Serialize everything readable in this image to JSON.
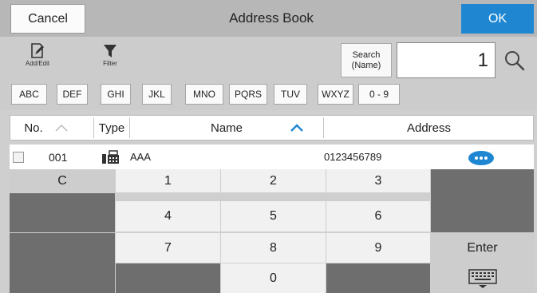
{
  "header": {
    "cancel_label": "Cancel",
    "title": "Address Book",
    "ok_label": "OK",
    "accent_color": "#1f87d2"
  },
  "toolbar": {
    "add_edit_label": "Add/Edit",
    "add_edit_icon": "edit-icon",
    "filter_label": "Filter",
    "filter_icon": "funnel-icon",
    "search_label_line1": "Search",
    "search_label_line2": "(Name)",
    "search_value": "1",
    "search_icon": "magnifier-icon"
  },
  "index_tabs": [
    "ABC",
    "DEF",
    "GHI",
    "JKL",
    "MNO",
    "PQRS",
    "TUV",
    "WXYZ",
    "0 - 9"
  ],
  "table": {
    "columns": {
      "no": "No.",
      "type": "Type",
      "name": "Name",
      "address": "Address"
    },
    "rows": [
      {
        "no": "001",
        "type_icon": "fax-icon",
        "name": "AAA",
        "address": "0123456789",
        "detail_icon": "more-icon"
      }
    ]
  },
  "keypad": {
    "clear": "C",
    "digits": [
      "1",
      "2",
      "3",
      "4",
      "5",
      "6",
      "7",
      "8",
      "9",
      "0"
    ],
    "enter": "Enter",
    "keyboard_icon": "keyboard-icon"
  }
}
